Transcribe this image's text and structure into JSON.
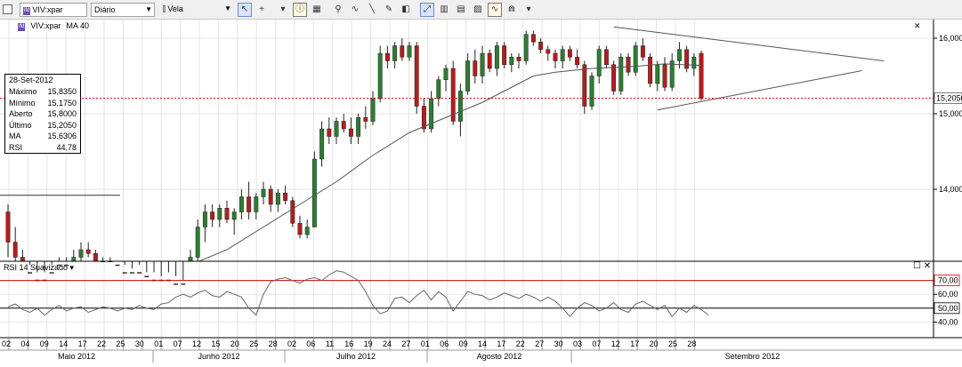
{
  "toolbar": {
    "symbol_badge": "ifd",
    "symbol": "VIV:xpar",
    "period": "Diário",
    "chart_type": "Vela",
    "buttons": [
      {
        "name": "cursor-icon",
        "glyph": "↖",
        "active": true
      },
      {
        "name": "crosshair-icon",
        "glyph": "+"
      },
      {
        "name": "dropdown-icon",
        "glyph": "▾"
      },
      {
        "name": "info-icon",
        "glyph": "ⓘ",
        "boxed": true
      },
      {
        "name": "grid-icon",
        "glyph": "▦"
      },
      {
        "name": "zoom-icon",
        "glyph": "⚲"
      },
      {
        "name": "indicators-icon",
        "glyph": "∿"
      },
      {
        "name": "line-tool-icon",
        "glyph": "╲"
      },
      {
        "name": "draw-icon",
        "glyph": "✎"
      },
      {
        "name": "paint-icon",
        "glyph": "◧"
      },
      {
        "name": "fit-icon",
        "glyph": "⤢",
        "active": true
      },
      {
        "name": "compare-icon",
        "glyph": "▥"
      },
      {
        "name": "template-icon",
        "glyph": "▤"
      },
      {
        "name": "scale-icon",
        "glyph": "▨"
      },
      {
        "name": "wave-icon",
        "glyph": "∿",
        "boxed": true
      },
      {
        "name": "magnet-icon",
        "glyph": "⋒"
      },
      {
        "name": "menu-icon",
        "glyph": "▾"
      }
    ]
  },
  "legend_main": {
    "badge": "ifd",
    "symbol": "VIV:xpar",
    "indicator": "MA 40"
  },
  "legend_rsi": {
    "label": "RSI 14 Suavizado"
  },
  "infobox": {
    "date": "28-Set-2012",
    "rows": [
      {
        "label": "Máximo",
        "value": "15,8350"
      },
      {
        "label": "Mínimo",
        "value": "15,1750"
      },
      {
        "label": "Aberto",
        "value": "15,8000"
      },
      {
        "label": "Último",
        "value": "15,2050"
      },
      {
        "label": "MA",
        "value": "15,6306"
      },
      {
        "label": "RSI",
        "value": "44,78"
      }
    ]
  },
  "price_axis": {
    "labels": [
      "16,000",
      "15,000",
      "14,000"
    ],
    "current": "15,2050"
  },
  "rsi_axis": {
    "labels": [
      "70,00",
      "60,00",
      "50,00",
      "40,00"
    ]
  },
  "date_axis": {
    "days": [
      "02",
      "04",
      "09",
      "14",
      "17",
      "22",
      "25",
      "30",
      "01",
      "07",
      "12",
      "15",
      "20",
      "25",
      "28",
      "02",
      "06",
      "11",
      "16",
      "19",
      "24",
      "27",
      "01",
      "06",
      "09",
      "14",
      "17",
      "22",
      "27",
      "30",
      "03",
      "07",
      "12",
      "17",
      "20",
      "25",
      "28"
    ],
    "months": [
      "Maio 2012",
      "Junho 2012",
      "Julho 2012",
      "Agosto 2012",
      "Setembro 2012"
    ]
  },
  "colors": {
    "up": "#2e7d32",
    "down": "#b71c1c",
    "ma": "#555555",
    "current_line": "#e00000",
    "rsi_band": "#cc0000"
  },
  "chart_data": {
    "type": "candlestick",
    "symbol": "VIV:xpar",
    "period": "Diário",
    "ylim": [
      13.0,
      16.2
    ],
    "rsi_ylim": [
      30,
      80
    ],
    "current_price": 15.205,
    "candles": [
      [
        13.7,
        13.8,
        13.1,
        13.3
      ],
      [
        13.3,
        13.5,
        13.0,
        13.1
      ],
      [
        13.1,
        13.2,
        12.8,
        12.9
      ],
      [
        12.9,
        13.0,
        12.7,
        12.8
      ],
      [
        12.8,
        12.9,
        12.6,
        12.7
      ],
      [
        12.7,
        12.9,
        12.6,
        12.8
      ],
      [
        12.8,
        13.0,
        12.7,
        12.9
      ],
      [
        12.9,
        13.1,
        12.8,
        13.0
      ],
      [
        13.0,
        13.1,
        12.9,
        12.95
      ],
      [
        12.95,
        13.2,
        12.9,
        13.1
      ],
      [
        13.1,
        13.3,
        13.0,
        13.2
      ],
      [
        13.2,
        13.3,
        13.1,
        13.15
      ],
      [
        13.15,
        13.2,
        12.9,
        13.0
      ],
      [
        13.0,
        13.1,
        12.9,
        13.05
      ],
      [
        13.05,
        13.1,
        12.95,
        13.0
      ],
      [
        13.0,
        13.05,
        12.8,
        12.9
      ],
      [
        12.9,
        13.0,
        12.7,
        12.8
      ],
      [
        12.8,
        12.95,
        12.7,
        12.9
      ],
      [
        12.9,
        13.0,
        12.8,
        12.85
      ],
      [
        12.85,
        12.9,
        12.7,
        12.8
      ],
      [
        12.8,
        12.9,
        12.6,
        12.7
      ],
      [
        12.7,
        12.85,
        12.65,
        12.8
      ],
      [
        12.8,
        12.9,
        12.7,
        12.75
      ],
      [
        12.75,
        12.85,
        12.6,
        12.7
      ],
      [
        12.7,
        12.8,
        12.6,
        12.75
      ],
      [
        12.75,
        13.2,
        12.7,
        13.1
      ],
      [
        13.1,
        13.6,
        13.0,
        13.5
      ],
      [
        13.5,
        13.8,
        13.3,
        13.7
      ],
      [
        13.7,
        13.8,
        13.5,
        13.6
      ],
      [
        13.6,
        13.8,
        13.5,
        13.75
      ],
      [
        13.75,
        13.85,
        13.55,
        13.6
      ],
      [
        13.6,
        13.75,
        13.4,
        13.7
      ],
      [
        13.7,
        14.0,
        13.6,
        13.9
      ],
      [
        13.9,
        14.1,
        13.6,
        13.7
      ],
      [
        13.7,
        13.95,
        13.6,
        13.9
      ],
      [
        13.9,
        14.1,
        13.8,
        14.0
      ],
      [
        14.0,
        14.05,
        13.7,
        13.8
      ],
      [
        13.8,
        14.0,
        13.7,
        13.95
      ],
      [
        13.95,
        14.05,
        13.8,
        13.85
      ],
      [
        13.85,
        13.9,
        13.5,
        13.55
      ],
      [
        13.55,
        13.65,
        13.35,
        13.4
      ],
      [
        13.4,
        13.6,
        13.35,
        13.5
      ],
      [
        13.5,
        14.5,
        13.5,
        14.4
      ],
      [
        14.4,
        14.9,
        14.3,
        14.8
      ],
      [
        14.8,
        14.95,
        14.6,
        14.7
      ],
      [
        14.7,
        14.95,
        14.6,
        14.9
      ],
      [
        14.9,
        15.0,
        14.75,
        14.8
      ],
      [
        14.8,
        14.95,
        14.6,
        14.7
      ],
      [
        14.7,
        15.0,
        14.6,
        14.95
      ],
      [
        14.95,
        15.1,
        14.8,
        14.9
      ],
      [
        14.9,
        15.3,
        14.85,
        15.2
      ],
      [
        15.2,
        15.9,
        15.15,
        15.8
      ],
      [
        15.8,
        15.9,
        15.6,
        15.7
      ],
      [
        15.7,
        15.95,
        15.6,
        15.9
      ],
      [
        15.9,
        16.0,
        15.7,
        15.75
      ],
      [
        15.75,
        15.95,
        15.7,
        15.9
      ],
      [
        15.9,
        15.95,
        15.0,
        15.1
      ],
      [
        15.1,
        15.2,
        14.75,
        14.8
      ],
      [
        14.8,
        15.3,
        14.75,
        15.2
      ],
      [
        15.2,
        15.5,
        15.1,
        15.45
      ],
      [
        15.45,
        15.65,
        15.3,
        15.6
      ],
      [
        15.6,
        15.7,
        14.85,
        14.9
      ],
      [
        14.9,
        15.4,
        14.7,
        15.3
      ],
      [
        15.3,
        15.8,
        15.25,
        15.7
      ],
      [
        15.7,
        15.85,
        15.4,
        15.5
      ],
      [
        15.5,
        15.9,
        15.4,
        15.8
      ],
      [
        15.8,
        15.85,
        15.55,
        15.6
      ],
      [
        15.6,
        15.95,
        15.5,
        15.9
      ],
      [
        15.9,
        15.95,
        15.6,
        15.65
      ],
      [
        15.65,
        15.8,
        15.55,
        15.75
      ],
      [
        15.75,
        15.8,
        15.6,
        15.7
      ],
      [
        15.7,
        16.1,
        15.65,
        16.05
      ],
      [
        16.05,
        16.1,
        15.9,
        15.95
      ],
      [
        15.95,
        16.0,
        15.8,
        15.85
      ],
      [
        15.85,
        15.9,
        15.7,
        15.8
      ],
      [
        15.8,
        15.85,
        15.6,
        15.7
      ],
      [
        15.7,
        15.9,
        15.6,
        15.85
      ],
      [
        15.85,
        15.9,
        15.7,
        15.75
      ],
      [
        15.75,
        15.85,
        15.6,
        15.65
      ],
      [
        15.65,
        15.7,
        15.0,
        15.1
      ],
      [
        15.1,
        15.55,
        15.05,
        15.5
      ],
      [
        15.5,
        15.9,
        15.4,
        15.85
      ],
      [
        15.85,
        15.9,
        15.6,
        15.65
      ],
      [
        15.65,
        15.7,
        15.25,
        15.3
      ],
      [
        15.3,
        15.8,
        15.25,
        15.75
      ],
      [
        15.75,
        15.8,
        15.5,
        15.55
      ],
      [
        15.55,
        15.95,
        15.5,
        15.9
      ],
      [
        15.9,
        16.0,
        15.7,
        15.75
      ],
      [
        15.75,
        15.8,
        15.35,
        15.4
      ],
      [
        15.4,
        15.7,
        15.3,
        15.65
      ],
      [
        15.65,
        15.75,
        15.3,
        15.35
      ],
      [
        15.35,
        15.8,
        15.3,
        15.7
      ],
      [
        15.7,
        15.95,
        15.6,
        15.85
      ],
      [
        15.85,
        15.9,
        15.55,
        15.6
      ],
      [
        15.6,
        15.8,
        15.5,
        15.75
      ],
      [
        15.8,
        15.835,
        15.175,
        15.205
      ]
    ],
    "ma_40": [
      [
        0,
        12.9
      ],
      [
        10,
        12.9
      ],
      [
        20,
        12.95
      ],
      [
        25,
        13.0
      ],
      [
        30,
        13.2
      ],
      [
        35,
        13.5
      ],
      [
        40,
        13.8
      ],
      [
        45,
        14.1
      ],
      [
        50,
        14.45
      ],
      [
        55,
        14.75
      ],
      [
        60,
        14.95
      ],
      [
        65,
        15.15
      ],
      [
        70,
        15.4
      ],
      [
        72,
        15.5
      ],
      [
        75,
        15.55
      ],
      [
        80,
        15.6
      ],
      [
        85,
        15.62
      ],
      [
        90,
        15.66
      ],
      [
        95,
        15.64
      ]
    ],
    "rsi": [
      51,
      53,
      49,
      47,
      50,
      45,
      49,
      52,
      48,
      50,
      51,
      47,
      49,
      51,
      50,
      48,
      50,
      49,
      52,
      50,
      49,
      53,
      54,
      58,
      60,
      58,
      61,
      63,
      59,
      58,
      62,
      60,
      58,
      50,
      45,
      60,
      69,
      71,
      72,
      70,
      68,
      71,
      72,
      70,
      74,
      77,
      76,
      73,
      70,
      62,
      52,
      46,
      48,
      57,
      58,
      54,
      59,
      63,
      56,
      62,
      58,
      48,
      55,
      62,
      60,
      59,
      56,
      58,
      61,
      59,
      57,
      60,
      58,
      55,
      58,
      55,
      50,
      44,
      50,
      54,
      52,
      48,
      50,
      54,
      49,
      47,
      53,
      55,
      52,
      49,
      52,
      44,
      50,
      47,
      52,
      49,
      45
    ],
    "trendlines": [
      {
        "from": [
          83,
          16.15
        ],
        "to": [
          120,
          15.7
        ]
      },
      {
        "from": [
          89,
          15.05
        ],
        "to": [
          117,
          15.57
        ]
      }
    ],
    "horizontal_line": 13.92,
    "rsi_levels": [
      70,
      50
    ]
  }
}
